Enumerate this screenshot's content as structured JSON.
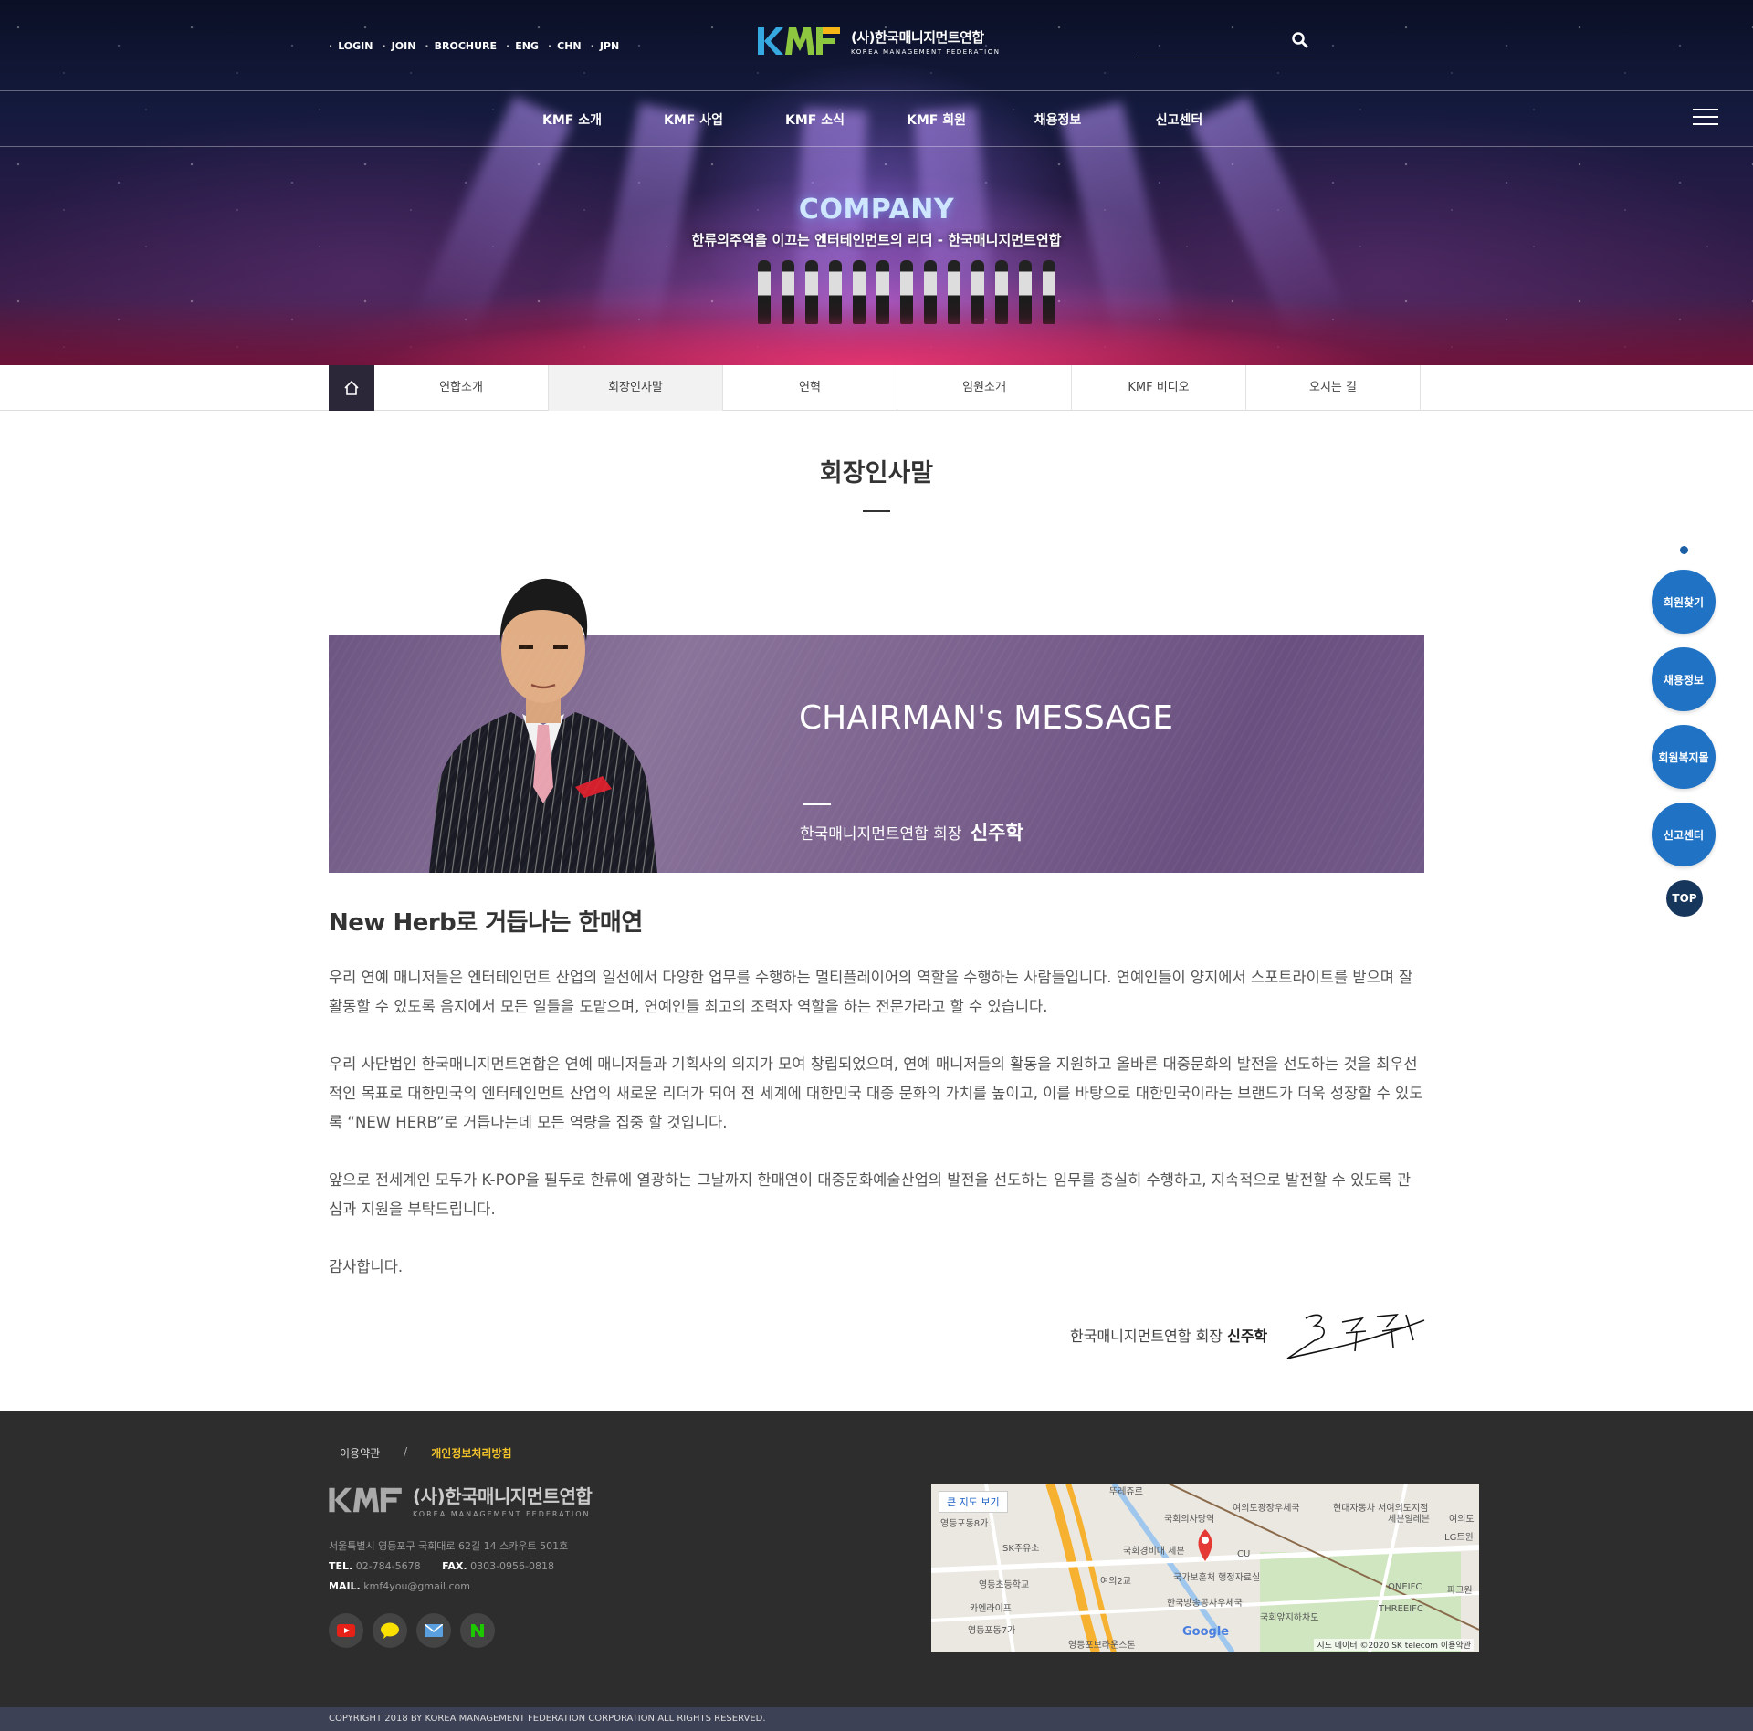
{
  "header": {
    "util_links": [
      "LOGIN",
      "JOIN",
      "BROCHURE",
      "ENG",
      "CHN",
      "JPN"
    ],
    "logo_ko": "(사)한국매니지먼트연합",
    "logo_en": "KOREA MANAGEMENT FEDERATION",
    "search_placeholder": "",
    "gnb": [
      "KMF 소개",
      "KMF 사업",
      "KMF 소식",
      "KMF 회원",
      "채용정보",
      "신고센터"
    ]
  },
  "hero": {
    "title": "COMPANY",
    "subtitle": "한류의주역을 이끄는 엔터테인먼트의 리더 - 한국매니지먼트연합"
  },
  "subnav": {
    "items": [
      "연합소개",
      "회장인사말",
      "연혁",
      "임원소개",
      "KMF 비디오",
      "오시는 길"
    ],
    "active": "회장인사말"
  },
  "content": {
    "page_title": "회장인사말",
    "banner_heading": "CHAIRMAN's MESSAGE",
    "banner_org": "한국매니지먼트연합  회장",
    "banner_name": "신주학",
    "heading": "New Herb로 거듭나는 한매연",
    "paragraphs": [
      "우리 연예 매니저들은 엔터테인먼트 산업의 일선에서 다양한 업무를 수행하는 멀티플레이어의 역할을 수행하는 사람들입니다. 연예인들이 양지에서 스포트라이트를 받으며 잘 활동할 수 있도록 음지에서 모든 일들을 도맡으며, 연예인들 최고의 조력자 역할을 하는 전문가라고 할 수 있습니다.",
      "우리 사단법인 한국매니지먼트연합은 연예 매니저들과 기획사의 의지가 모여 창립되었으며, 연예 매니저들의 활동을 지원하고 올바른 대중문화의 발전을 선도하는 것을 최우선적인 목표로 대한민국의 엔터테인먼트 산업의 새로운 리더가 되어 전 세계에 대한민국 대중 문화의 가치를 높이고, 이를 바탕으로 대한민국이라는 브랜드가 더욱 성장할 수 있도록 “NEW HERB”로 거듭나는데 모든 역량을 집중 할 것입니다.",
      "앞으로 전세계인 모두가 K-POP을 필두로 한류에 열광하는 그날까지 한매연이 대중문화예술산업의 발전을 선도하는 임무를 충실히 수행하고, 지속적으로 발전할 수 있도록 관심과 지원을 부탁드립니다.",
      "감사합니다."
    ],
    "sign_org": "한국매니지먼트연합 회장",
    "sign_name": "신주학"
  },
  "quick_menu": [
    "회원찾기",
    "채용정보",
    "회원복지몰",
    "신고센터"
  ],
  "top_label": "TOP",
  "footer": {
    "terms": "이용약관",
    "sep": "/",
    "privacy": "개인정보처리방침",
    "logo_ko": "(사)한국매니지먼트연합",
    "logo_en": "KOREA MANAGEMENT FEDERATION",
    "address": "서울특별시 영등포구 국회대로 62길 14 스카우트 501호",
    "tel_label": "TEL.",
    "tel": "02-784-5678",
    "fax_label": "FAX.",
    "fax": "0303-0956-0818",
    "mail_label": "MAIL.",
    "mail": "kmf4you@gmail.com",
    "sns": [
      "youtube-icon",
      "kakaotalk-icon",
      "mail-icon",
      "naver-icon"
    ],
    "map": {
      "big_map_button": "큰 지도 보기",
      "labels": [
        "뚜레쥬르",
        "국회의사당역",
        "여의도광장우체국",
        "현대자동차 서여의도지점",
        "세븐일레븐",
        "여의도",
        "영등포동8가",
        "SK주유소",
        "국회경비대 세븐",
        "CU",
        "LG트윈",
        "영등초등학교",
        "여의2교",
        "국가보훈처 행정자료실",
        "ONEIFC",
        "파크원",
        "카엔라이프",
        "한국방송공사우체국",
        "THREEIFC",
        "영등포동7가",
        "국회앞지하차도",
        "영등포브라운스톤",
        "파크원"
      ],
      "google": "Google",
      "credit": "지도 데이터 ©2020 SK telecom   이용약관"
    },
    "copyright": "COPYRIGHT 2018 BY KOREA MANAGEMENT FEDERATION CORPORATION ALL RIGHTS RESERVED."
  },
  "colors": {
    "quick_blue": "#1f72c4",
    "top_navy": "#17365c",
    "banner_purple": "#7b628e",
    "footer_bg": "#2d2d2d",
    "privacy_yellow": "#f5c52a"
  }
}
